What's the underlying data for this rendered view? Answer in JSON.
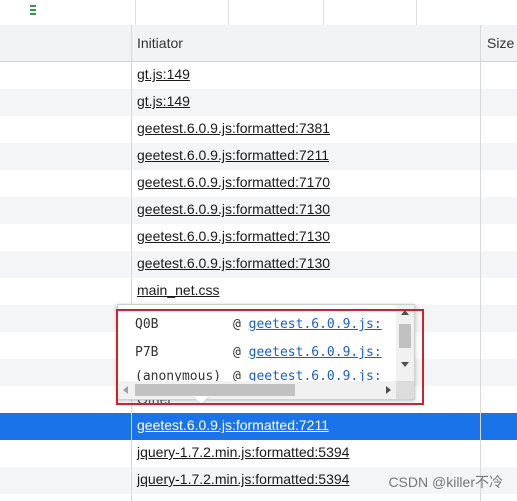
{
  "header": {
    "initiator": "Initiator",
    "size": "Size"
  },
  "rows": [
    {
      "text": "gt.js:149",
      "link": true
    },
    {
      "text": "gt.js:149",
      "link": true
    },
    {
      "text": "geetest.6.0.9.js:formatted:7381",
      "link": true
    },
    {
      "text": "geetest.6.0.9.js:formatted:7211",
      "link": true
    },
    {
      "text": "geetest.6.0.9.js:formatted:7170",
      "link": true
    },
    {
      "text": "geetest.6.0.9.js:formatted:7130",
      "link": true
    },
    {
      "text": "geetest.6.0.9.js:formatted:7130",
      "link": true
    },
    {
      "text": "geetest.6.0.9.js:formatted:7130",
      "link": true
    },
    {
      "text": "main_net.css",
      "link": true
    },
    {
      "text": "",
      "link": false
    },
    {
      "text": "",
      "link": false
    },
    {
      "text": "",
      "link": false
    },
    {
      "text": "Other",
      "link": false
    },
    {
      "text": "geetest.6.0.9.js:formatted:7211",
      "link": true,
      "selected": true
    },
    {
      "text": "jquery-1.7.2.min.js:formatted:5394",
      "link": true
    },
    {
      "text": "jquery-1.7.2.min.js:formatted:5394",
      "link": true
    }
  ],
  "popup": {
    "lines": [
      {
        "fn": "Q0B",
        "at": "@",
        "src": "geetest.6.0.9.js:"
      },
      {
        "fn": "P7B",
        "at": "@",
        "src": "geetest.6.0.9.js:"
      },
      {
        "fn": "(anonymous)",
        "at": "@",
        "src": "geetest.6.0.9.js:"
      }
    ]
  },
  "watermark": "CSDN @killer不冷",
  "colors": {
    "selected_row": "#1a73e8",
    "highlight_frame": "#d0222a",
    "link": "#1a5fd0"
  }
}
